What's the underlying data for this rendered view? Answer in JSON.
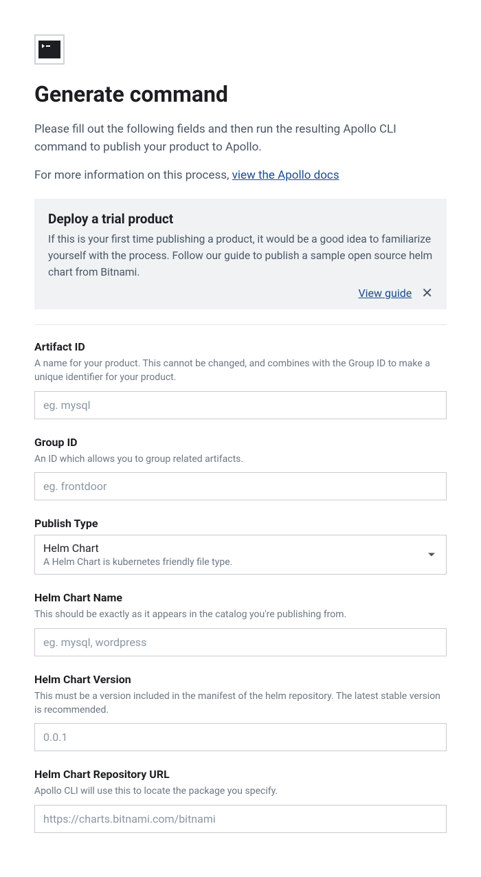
{
  "header": {
    "title": "Generate command",
    "intro": "Please fill out the following fields and then run the resulting Apollo CLI command to publish your product to Apollo.",
    "more_info_prefix": "For more information on this process, ",
    "docs_link_text": "view the Apollo docs"
  },
  "banner": {
    "title": "Deploy a trial product",
    "body": "If this is your first time publishing a product, it would be a good idea to familiarize yourself with the process. Follow our guide to publish a sample open source helm chart from Bitnami.",
    "view_guide_label": "View guide"
  },
  "fields": {
    "artifact_id": {
      "label": "Artifact ID",
      "help": "A name for your product. This cannot be changed, and combines with the Group ID to make a unique identifier for your product.",
      "placeholder": "eg. mysql",
      "value": ""
    },
    "group_id": {
      "label": "Group ID",
      "help": "An ID which allows you to group related artifacts.",
      "placeholder": "eg. frontdoor",
      "value": ""
    },
    "publish_type": {
      "label": "Publish Type",
      "selected_value": "Helm Chart",
      "selected_desc": "A Helm Chart is kubernetes friendly file type."
    },
    "helm_chart_name": {
      "label": "Helm Chart Name",
      "help": "This should be exactly as it appears in the catalog you're publishing from.",
      "placeholder": "eg. mysql, wordpress",
      "value": ""
    },
    "helm_chart_version": {
      "label": "Helm Chart Version",
      "help": "This must be a version included in the manifest of the helm repository. The latest stable version is recommended.",
      "placeholder": "0.0.1",
      "value": ""
    },
    "helm_chart_repo_url": {
      "label": "Helm Chart Repository URL",
      "help": "Apollo CLI will use this to locate the package you specify.",
      "placeholder": "https://charts.bitnami.com/bitnami",
      "value": ""
    }
  }
}
